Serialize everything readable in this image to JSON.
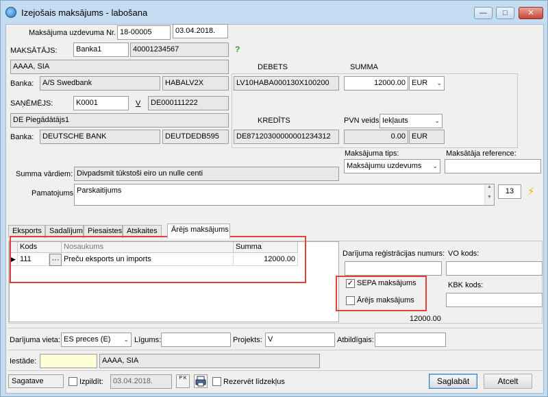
{
  "window": {
    "title": "Izejošais maksājums - labošana"
  },
  "header": {
    "order_number_label": "Maksājuma uzdevuma Nr.",
    "order_number": "18-00005",
    "order_date": "03.04.2018."
  },
  "payer": {
    "label": "MAKSĀTĀJS:",
    "code": "Banka1",
    "account_id": "40001234567",
    "help_icon": "?",
    "name": "AAAA, SIA",
    "bank_label": "Banka:",
    "bank_name": "A/S Swedbank",
    "bank_swift": "HABALV2X"
  },
  "debit": {
    "label": "DEBETS",
    "account": "LV10HABA000130X100200"
  },
  "sum": {
    "label": "SUMMA",
    "amount": "12000.00",
    "currency": "EUR"
  },
  "beneficiary": {
    "label": "SAŅĒMĒJS:",
    "code": "K0001",
    "v_link": "V",
    "reg_number": "DE000111222",
    "name": "DE Piegādātājs1",
    "bank_label": "Banka:",
    "bank_name": "DEUTSCHE BANK",
    "bank_swift": "DEUTDEDB595"
  },
  "credit": {
    "label": "KREDĪTS",
    "account": "DE87120300000001234312"
  },
  "vat": {
    "label": "PVN veids:",
    "type": "Iekļauts",
    "amount": "0.00",
    "currency": "EUR"
  },
  "payment_type": {
    "label": "Maksājuma tips:",
    "value": "Maksājumu uzdevums"
  },
  "payer_reference": {
    "label": "Maksātāja reference:",
    "value": ""
  },
  "amount_in_words": {
    "label": "Summa vārdiem:",
    "value": "Divpadsmit tūkstoši eiro un nulle centi"
  },
  "purpose": {
    "label": "Pamatojums:",
    "value": "Parskaitijums",
    "number": "13"
  },
  "tabs": [
    {
      "label": "Eksports"
    },
    {
      "label": "Sadalījums"
    },
    {
      "label": "Piesaistes"
    },
    {
      "label": "Atskaites"
    },
    {
      "label": "Ārējs maksājums"
    }
  ],
  "grid": {
    "columns": [
      "Kods",
      "Nosaukums",
      "Summa"
    ],
    "rows": [
      {
        "code": "111",
        "ellipsis": "···",
        "name": "Preču eksports un imports",
        "sum": "12000.00"
      }
    ]
  },
  "external": {
    "reg_number_label": "Darījuma reģistrācijas numurs:",
    "reg_number_value": "",
    "vo_label": "VO kods:",
    "vo_value": "",
    "kbk_label": "KBK kods:",
    "kbk_value": "",
    "sepa_label": "SEPA maksājums",
    "sepa_checked": true,
    "external_label": "Ārējs maksājums",
    "external_checked": false,
    "total": "12000.00"
  },
  "footer_fields": {
    "place_label": "Darījuma vieta:",
    "place_value": "ES preces (E)",
    "contract_label": "Līgums:",
    "contract_value": "",
    "projects_label": "Projekts:",
    "projects_value": "V",
    "responsible_label": "Atbildīgais:",
    "responsible_value": "",
    "institution_label": "Iestāde:",
    "institution_code": "",
    "institution_name": "AAAA, SIA"
  },
  "bottom": {
    "status": "Sagatave",
    "execute_label": "Izpildīt:",
    "execute_date": "03.04.2018.",
    "pk_icon": "P K",
    "reserve_label": "Rezervēt līdzekļus",
    "save_label": "Saglabāt",
    "cancel_label": "Atcelt"
  },
  "colors": {
    "highlight_box": "#e0403a",
    "field_yellow": "#ffffd7",
    "window_frame": "#c3dcf1"
  }
}
